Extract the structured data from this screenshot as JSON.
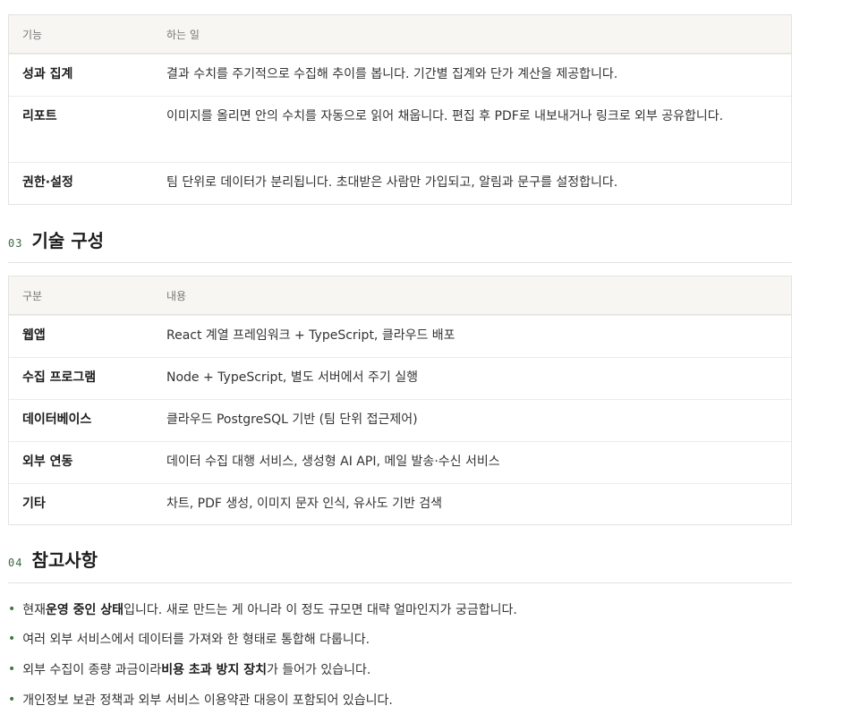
{
  "features_table": {
    "col1_header": "기능",
    "col2_header": "하는 일",
    "rows": [
      {
        "name": "성과 집계",
        "desc": "결과 수치를 주기적으로 수집해 추이를 봅니다. 기간별 집계와 단가 계산을 제공합니다."
      },
      {
        "name": "리포트",
        "desc": "이미지를 올리면 안의 수치를 자동으로 읽어 채웁니다. 편집 후 PDF로 내보내거나 링크로 외부 공유합니다."
      },
      {
        "name": "권한·설정",
        "desc": "팀 단위로 데이터가 분리됩니다. 초대받은 사람만 가입되고, 알림과 문구를 설정합니다."
      }
    ]
  },
  "section3": {
    "num": "03",
    "title": "기술 구성"
  },
  "tech_table": {
    "col1_header": "구분",
    "col2_header": "내용",
    "rows": [
      {
        "name": "웹앱",
        "desc": "React 계열 프레임워크 + TypeScript, 클라우드 배포"
      },
      {
        "name": "수집 프로그램",
        "desc": "Node + TypeScript, 별도 서버에서 주기 실행"
      },
      {
        "name": "데이터베이스",
        "desc": "클라우드 PostgreSQL 기반 (팀 단위 접근제어)"
      },
      {
        "name": "외부 연동",
        "desc": "데이터 수집 대행 서비스, 생성형 AI API, 메일 발송·수신 서비스"
      },
      {
        "name": "기타",
        "desc": "차트, PDF 생성, 이미지 문자 인식, 유사도 기반 검색"
      }
    ]
  },
  "section4": {
    "num": "04",
    "title": "참고사항"
  },
  "notes": [
    {
      "pre": "현재 ",
      "bold": "운영 중인 상태",
      "post": "입니다. 새로 만드는 게 아니라 이 정도 규모면 대략 얼마인지가 궁금합니다."
    },
    {
      "pre": "여러 외부 서비스에서 데이터를 가져와 한 형태로 통합해 다룹니다.",
      "bold": "",
      "post": ""
    },
    {
      "pre": "외부 수집이 종량 과금이라 ",
      "bold": "비용 초과 방지 장치",
      "post": "가 들어가 있습니다."
    },
    {
      "pre": "개인정보 보관 정책과 외부 서비스 이용약관 대응이 포함되어 있습니다.",
      "bold": "",
      "post": ""
    }
  ],
  "colors": {
    "accent": "#3a7a3a",
    "header_bg": "#f7f6f2",
    "border": "#e3e3df"
  }
}
